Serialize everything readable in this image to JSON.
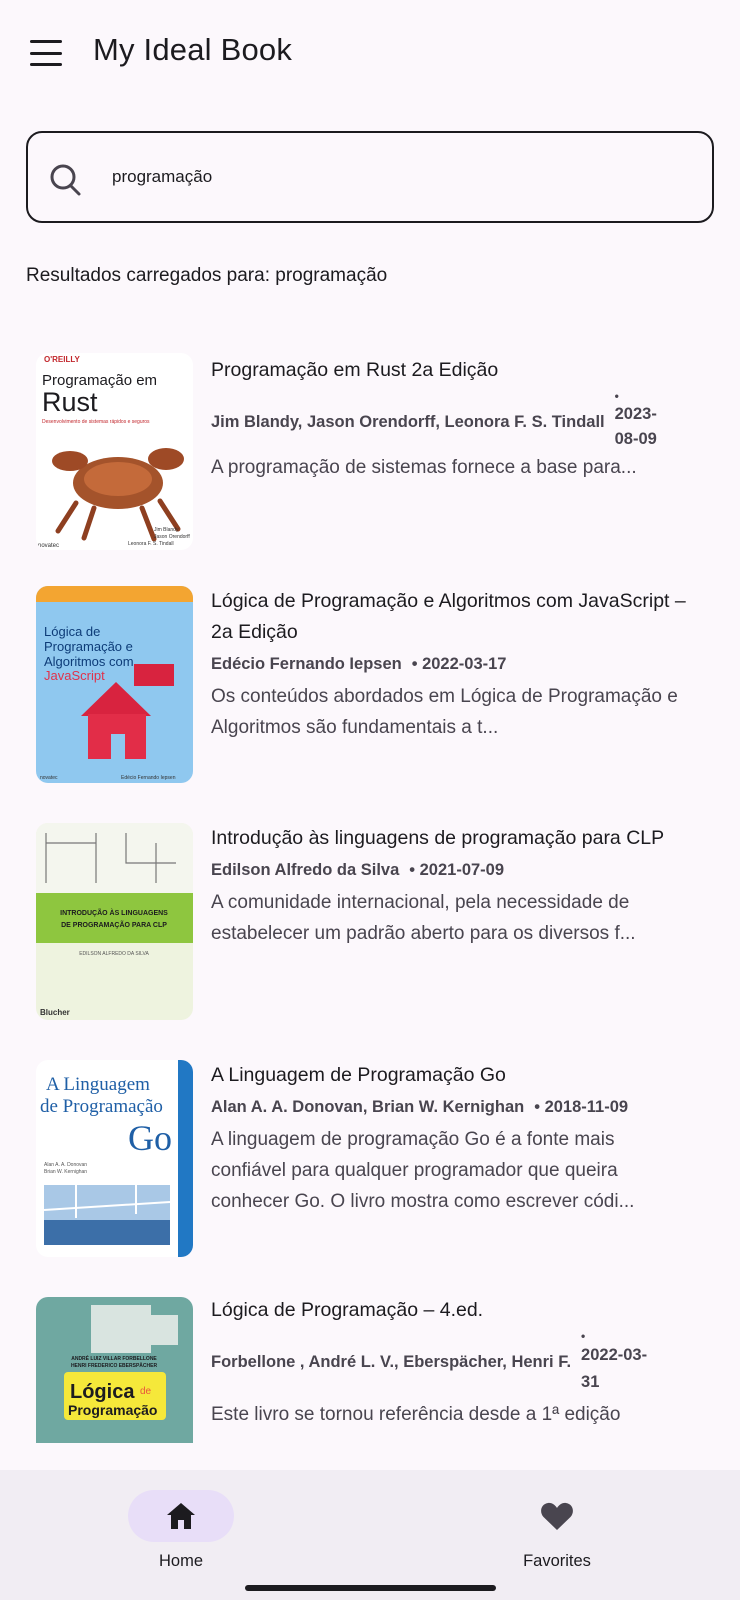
{
  "app": {
    "title": "My Ideal Book"
  },
  "search": {
    "value": "programação"
  },
  "results_label": "Resultados carregados para: programação",
  "books": [
    {
      "title": "Programação em Rust 2a Edição",
      "authors": "Jim Blandy, Jason Orendorff, Leonora F. S. Tindall",
      "date_prefix": "•",
      "date": "2023-08-09",
      "description": "A programação de sistemas fornece a base para...",
      "cover": {
        "publisher": "O'REILLY",
        "line1": "Programação em",
        "line2": "Rust",
        "subtitle": "Desenvolvimento de sistemas rápidos e seguros",
        "credits": "Jim Blandy\nJason Orendorff\nLeonora F. S. Tindall",
        "brand": "novatec"
      }
    },
    {
      "title": "Lógica de Programação e Algoritmos com JavaScript – 2a Edição",
      "authors": "Edécio Fernando Iepsen",
      "date": "• 2022-03-17",
      "description": "Os conteúdos abordados em Lógica de Programação e Algoritmos são fundamentais a t...",
      "cover": {
        "line1": "Lógica de",
        "line2": "Programação e",
        "line3": "Algoritmos com",
        "line4": "JavaScript",
        "brand": "novatec",
        "author": "Edécio Fernando Iepsen"
      }
    },
    {
      "title": "Introdução às linguagens de programação para CLP",
      "authors": "Edilson Alfredo da Silva",
      "date": "• 2021-07-09",
      "description": "A comunidade internacional, pela necessidade de estabelecer um padrão aberto para os diversos f...",
      "cover": {
        "line1": "INTRODUÇÃO ÀS LINGUAGENS",
        "line2": "DE PROGRAMAÇÃO PARA CLP",
        "author": "EDILSON ALFREDO DA SILVA",
        "brand": "Blucher"
      }
    },
    {
      "title": "A Linguagem de Programação Go",
      "authors": "Alan A. A. Donovan, Brian W. Kernighan",
      "date": "• 2018-11-09",
      "description": "A linguagem de programação Go é a fonte mais confiável para qualquer programador que queira conhecer Go. O livro mostra como escrever códi...",
      "cover": {
        "line1": "A Linguagem",
        "line2": "de Programação",
        "line3": "Go",
        "credits": "Alan A. A. Donovan\nBrian W. Kernighan"
      }
    },
    {
      "title": "Lógica de Programação – 4.ed.",
      "authors": "Forbellone , André L. V., Eberspächer, Henri F.",
      "date_prefix": "•",
      "date": "2022-03-31",
      "description": "Este livro se tornou referência desde a 1ª edição",
      "cover": {
        "authors": "ANDRÉ LUIZ VILLAR FORBELLONE\nHENRI FREDERICO EBERSPÄCHER",
        "line1": "Lógica",
        "line2": "de",
        "line3": "Programação"
      }
    }
  ],
  "nav": {
    "items": [
      {
        "label": "Home",
        "icon": "home-icon",
        "active": true
      },
      {
        "label": "Favorites",
        "icon": "heart-icon",
        "active": false
      }
    ]
  },
  "colors": {
    "accent": "#e8def8",
    "nav_bg": "#f1edf3",
    "bg": "#fcf8fc"
  }
}
